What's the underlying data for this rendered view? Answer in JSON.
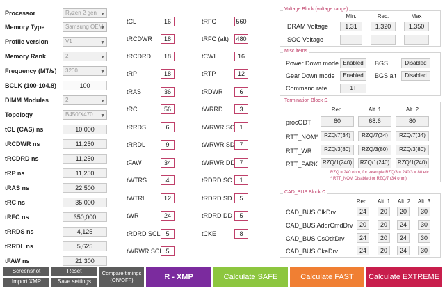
{
  "left": {
    "processor": {
      "label": "Processor",
      "value": "Ryzen 2 gen"
    },
    "memory_type": {
      "label": "Memory Type",
      "value": "Samsung OEM"
    },
    "profile_version": {
      "label": "Profile version",
      "value": "V1"
    },
    "memory_rank": {
      "label": "Memory Rank",
      "value": "2"
    },
    "frequency": {
      "label": "Frequency (MT/s)",
      "value": "3200"
    },
    "bclk": {
      "label": "BCLK (100-104.8)",
      "value": "100"
    },
    "dimm_modules": {
      "label": "DIMM Modules",
      "value": "2"
    },
    "topology": {
      "label": "Topology",
      "value": "B450/X470"
    },
    "ns": [
      {
        "label": "tCL (CAS) ns",
        "value": "10,000"
      },
      {
        "label": "tRCDWR ns",
        "value": "11,250"
      },
      {
        "label": "tRCDRD ns",
        "value": "11,250"
      },
      {
        "label": "tRP ns",
        "value": "11,250"
      },
      {
        "label": "tRAS ns",
        "value": "22,500"
      },
      {
        "label": "tRC ns",
        "value": "35,000"
      },
      {
        "label": "tRFC ns",
        "value": "350,000"
      },
      {
        "label": "tRRDS ns",
        "value": "4,125"
      },
      {
        "label": "tRRDL ns",
        "value": "5,625"
      },
      {
        "label": "tFAW ns",
        "value": "21,300"
      }
    ]
  },
  "timings_col1": [
    {
      "label": "tCL",
      "value": "16"
    },
    {
      "label": "tRCDWR",
      "value": "18"
    },
    {
      "label": "tRCDRD",
      "value": "18"
    },
    {
      "label": "tRP",
      "value": "18"
    },
    {
      "label": "tRAS",
      "value": "36"
    },
    {
      "label": "tRC",
      "value": "56"
    },
    {
      "label": "tRRDS",
      "value": "6"
    },
    {
      "label": "tRRDL",
      "value": "9"
    },
    {
      "label": "tFAW",
      "value": "34"
    },
    {
      "label": "tWTRS",
      "value": "4"
    },
    {
      "label": "tWTRL",
      "value": "12"
    },
    {
      "label": "tWR",
      "value": "24"
    },
    {
      "label": "tRDRD SCL",
      "value": "5"
    },
    {
      "label": "tWRWR SCL",
      "value": "5"
    }
  ],
  "timings_col2": [
    {
      "label": "tRFC",
      "value": "560"
    },
    {
      "label": "tRFC (alt)",
      "value": "480"
    },
    {
      "label": "tCWL",
      "value": "16"
    },
    {
      "label": "tRTP",
      "value": "12"
    },
    {
      "label": "tRDWR",
      "value": "6"
    },
    {
      "label": "tWRRD",
      "value": "3"
    },
    {
      "label": "tWRWR SC",
      "value": "1"
    },
    {
      "label": "tWRWR SD",
      "value": "7"
    },
    {
      "label": "tWRWR DD",
      "value": "7"
    },
    {
      "label": "tRDRD SC",
      "value": "1"
    },
    {
      "label": "tRDRD SD",
      "value": "5"
    },
    {
      "label": "tRDRD DD",
      "value": "5"
    },
    {
      "label": "tCKE",
      "value": "8"
    }
  ],
  "voltage": {
    "title": "Voltage Block (voltage range)",
    "headers": [
      "Min.",
      "Rec.",
      "Max"
    ],
    "dram_label": "DRAM Voltage",
    "dram": [
      "1.31",
      "1.320",
      "1.350"
    ],
    "soc_label": "SOC Voltage"
  },
  "misc": {
    "title": "Misc items",
    "power_down_label": "Power Down mode",
    "power_down": "Enabled",
    "bgs_label": "BGS",
    "bgs": "Disabled",
    "gear_down_label": "Gear Down mode",
    "gear_down": "Enabled",
    "bgs_alt_label": "BGS alt",
    "bgs_alt": "Disabled",
    "command_rate_label": "Command rate",
    "command_rate": "1T"
  },
  "termination": {
    "title": "Termination Block Ω",
    "headers": [
      "Rec.",
      "Alt. 1",
      "Alt. 2"
    ],
    "rows": [
      {
        "label": "procODT",
        "values": [
          "60",
          "68.6",
          "80"
        ]
      },
      {
        "label": "RTT_NOM*",
        "values": [
          "RZQ/7(34)",
          "RZQ/7(34)",
          "RZQ/7(34)"
        ]
      },
      {
        "label": "RTT_WR",
        "values": [
          "RZQ/3(80)",
          "RZQ/3(80)",
          "RZQ/3(80)"
        ]
      },
      {
        "label": "RTT_PARK",
        "values": [
          "RZQ/1(240)",
          "RZQ/1(240)",
          "RZQ/1(240)"
        ]
      }
    ],
    "note1": "RZQ = 240 ohm, for example RZQ/3 = 240/3 = 80 etc.",
    "note2": "* RTT_NOM Disabled or RZQ/7 (34 ohm)"
  },
  "cad_bus": {
    "title": "CAD_BUS Block Ω",
    "headers": [
      "Rec.",
      "Alt. 1",
      "Alt. 2",
      "Alt. 3"
    ],
    "rows": [
      {
        "label": "CAD_BUS ClkDrv",
        "values": [
          "24",
          "20",
          "20",
          "30"
        ]
      },
      {
        "label": "CAD_BUS AddrCmdDrv",
        "values": [
          "20",
          "20",
          "24",
          "30"
        ]
      },
      {
        "label": "CAD_BUS CsOdtDrv",
        "values": [
          "24",
          "20",
          "24",
          "30"
        ]
      },
      {
        "label": "CAD_BUS CkeDrv",
        "values": [
          "24",
          "20",
          "24",
          "30"
        ]
      }
    ]
  },
  "buttons": {
    "screenshot": "Screenshot",
    "reset": "Reset",
    "import_xmp": "Import XMP",
    "save_settings": "Save settings",
    "compare_timings_line1": "Compare timings",
    "compare_timings_line2": "(ON/OFF)",
    "r_xmp": "R - XMP",
    "calc_safe": "Calculate SAFE",
    "calc_fast": "Calculate FAST",
    "calc_extreme": "Calculate EXTREME"
  },
  "colors": {
    "accent": "#c0406a",
    "r_xmp": "#7b2b9e",
    "safe": "#8dc63f",
    "fast": "#f07f33",
    "extreme": "#c81e4c",
    "small_button": "#5c5c5c"
  }
}
